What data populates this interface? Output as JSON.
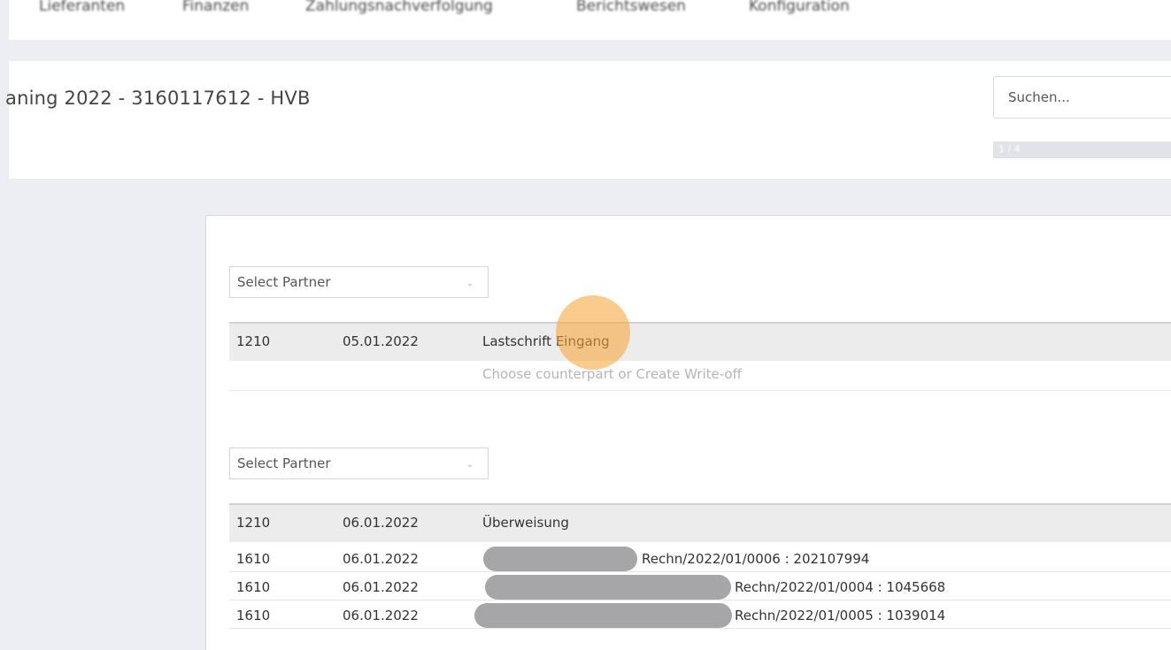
{
  "nav": {
    "items": [
      "Lieferanten",
      "Finanzen",
      "Zahlungsnachverfolgung",
      "Berichtswesen",
      "Konfiguration"
    ]
  },
  "header": {
    "title": "aning 2022 - 3160117612 - HVB",
    "search_placeholder": "Suchen...",
    "pager": "1 / 4"
  },
  "groups": [
    {
      "select_label": "Select Partner",
      "main": {
        "account": "1210",
        "date": "05.01.2022",
        "description": "Lastschrift Eingang"
      },
      "hint": "Choose counterpart or Create Write-off"
    },
    {
      "select_label": "Select Partner",
      "main": {
        "account": "1210",
        "date": "06.01.2022",
        "description": "Überweisung"
      },
      "lines": [
        {
          "account": "1610",
          "date": "06.01.2022",
          "reference": "Rechn/2022/01/0006 : 202107994"
        },
        {
          "account": "1610",
          "date": "06.01.2022",
          "reference": "Rechn/2022/01/0004 : 1045668"
        },
        {
          "account": "1610",
          "date": "06.01.2022",
          "reference": "Rechn/2022/01/0005 : 1039014"
        }
      ]
    }
  ]
}
